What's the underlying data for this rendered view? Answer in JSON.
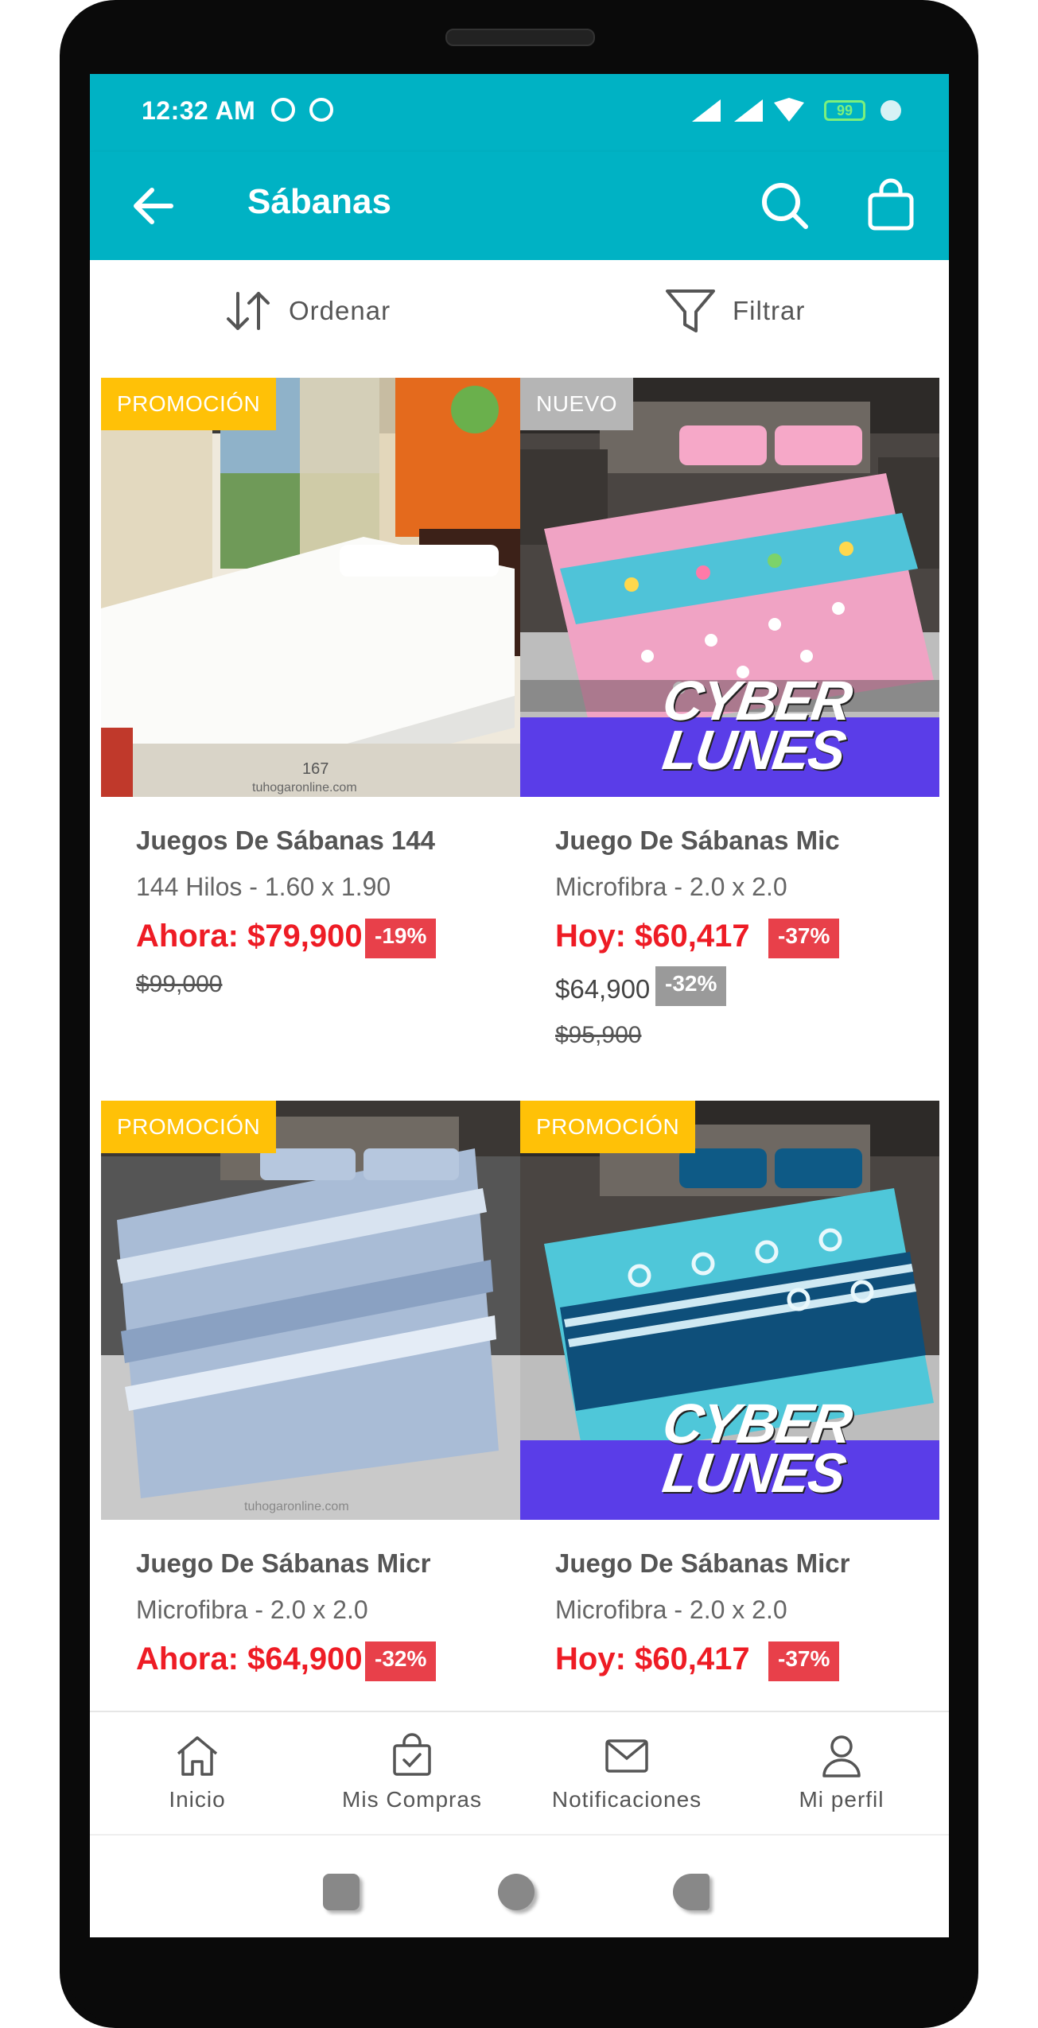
{
  "status_bar": {
    "time": "12:32 AM",
    "battery": "99"
  },
  "app_bar": {
    "title": "Sábanas"
  },
  "toolbar": {
    "sort_label": "Ordenar",
    "filter_label": "Filtrar"
  },
  "products": [
    {
      "badge": "PROMOCIÓN",
      "name": "Juegos De Sábanas 144",
      "desc": "144 Hilos - 1.60 x 1.90",
      "price": "Ahora: $79,900",
      "discount": "-19%",
      "old_price": "$99,000",
      "image_text": "167\ntuhogaronline.com"
    },
    {
      "badge": "NUEVO",
      "name": "Juego De Sábanas Mic",
      "desc": "Microfibra - 2.0 x 2.0",
      "price": "Hoy: $60,417",
      "discount": "-37%",
      "alt_price": "$64,900",
      "alt_discount": "-32%",
      "old_price": "$95,900",
      "banner_line1": "CYBER",
      "banner_line2": "LUNES"
    },
    {
      "badge": "PROMOCIÓN",
      "name": "Juego De Sábanas Micr",
      "desc": "Microfibra - 2.0 x 2.0",
      "price": "Ahora: $64,900",
      "discount": "-32%",
      "image_text": "tuhogaronline.com"
    },
    {
      "badge": "PROMOCIÓN",
      "name": "Juego De Sábanas Micr",
      "desc": "Microfibra - 2.0 x 2.0",
      "price": "Hoy: $60,417",
      "discount": "-37%",
      "banner_line1": "CYBER",
      "banner_line2": "LUNES"
    }
  ],
  "bottom_nav": [
    {
      "label": "Inicio",
      "icon": "home-icon"
    },
    {
      "label": "Mis Compras",
      "icon": "shopping-bag-check-icon"
    },
    {
      "label": "Notificaciones",
      "icon": "mail-icon"
    },
    {
      "label": "Mi perfil",
      "icon": "user-icon"
    }
  ],
  "colors": {
    "primary": "#00B2C4",
    "price_red": "#EE1C25",
    "promo_yellow": "#FFC107",
    "discount_red": "#E8404A"
  }
}
